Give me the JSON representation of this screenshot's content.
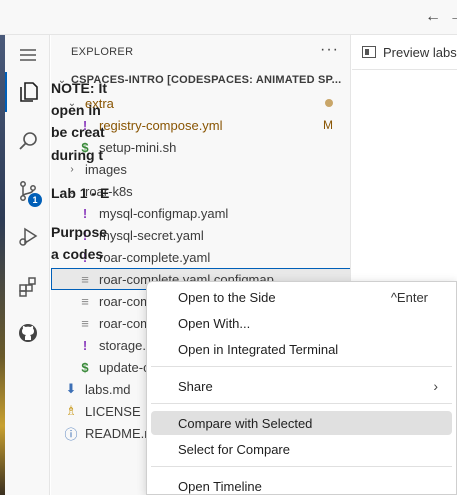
{
  "titlebar": {
    "back_icon": "←",
    "forward_icon": "→"
  },
  "activity": {
    "scm_badge": "1",
    "items": [
      "explorer-icon",
      "search-icon",
      "source-control-icon",
      "run-debug-icon",
      "extensions-icon",
      "github-icon"
    ]
  },
  "sidebar": {
    "header": "EXPLORER",
    "more": "···",
    "root": "CSPACES-INTRO [CODESPACES: ANIMATED SP...",
    "tree": {
      "extra": "extra",
      "registry": "registry-compose.yml",
      "registry_status": "M",
      "setup": "setup-mini.sh",
      "images": "images",
      "roar_k8s": "roar-k8s",
      "mysql_configmap": "mysql-configmap.yaml",
      "mysql_secret": "mysql-secret.yaml",
      "roar_complete": "roar-complete.yaml",
      "roar_complete_cm": "roar-complete.yaml.configmap",
      "roar_com_1": "roar-com",
      "roar_com_2": "roar-com",
      "storage": "storage.y",
      "update": "update-c",
      "labs": "labs.md",
      "license": "LICENSE",
      "readme": "README.r"
    }
  },
  "editor": {
    "tab_label": "Preview labs",
    "lines": [
      "NOTE: It",
      "open in",
      "be creat",
      "during t",
      "Lab 1 - E",
      "Purpose",
      "a codes"
    ]
  },
  "context_menu": {
    "open_side": "Open to the Side",
    "open_side_kb": "^Enter",
    "open_with": "Open With...",
    "open_terminal": "Open in Integrated Terminal",
    "share": "Share",
    "share_arrow": "›",
    "compare_selected": "Compare with Selected",
    "select_compare": "Select for Compare",
    "open_timeline": "Open Timeline"
  },
  "colors": {
    "accent": "#005fb8",
    "modified": "#895503",
    "yaml": "#8b3dbd",
    "shell": "#3a8a3a"
  }
}
